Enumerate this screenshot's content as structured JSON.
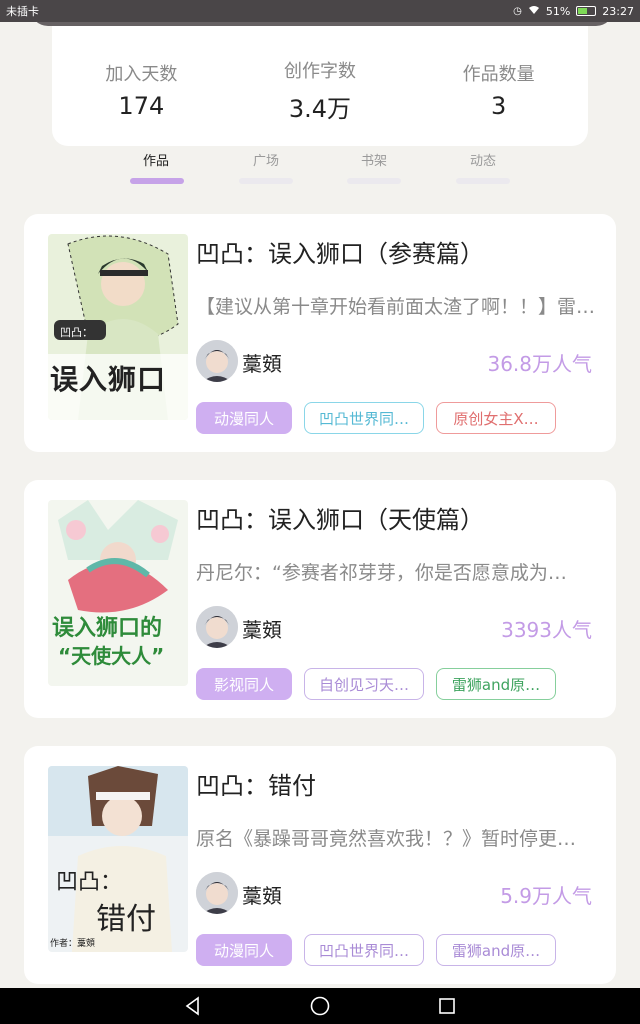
{
  "status_bar": {
    "carrier": "未插卡",
    "battery": "51%",
    "time": "23:27"
  },
  "stats": [
    {
      "label": "加入天数",
      "value": "174"
    },
    {
      "label": "创作字数",
      "value": "3.4万"
    },
    {
      "label": "作品数量",
      "value": "3"
    }
  ],
  "tabs": [
    {
      "label": "作品",
      "active": true
    },
    {
      "label": "广场",
      "active": false
    },
    {
      "label": "书架",
      "active": false
    },
    {
      "label": "动态",
      "active": false
    }
  ],
  "works": [
    {
      "title": "凹凸：误入狮口（参赛篇）",
      "description": "【建议从第十章开始看前面太渣了啊！！】雷…",
      "author": "藳頞",
      "popularity": "36.8万人气",
      "cover_text": [
        "凹凸：",
        "误入狮口"
      ],
      "tags": [
        "动漫同人",
        "凹凸世界同…",
        "原创女主X…"
      ]
    },
    {
      "title": "凹凸：误入狮口（天使篇）",
      "description": "丹尼尔：“参赛者祁芽芽，你是否愿意成为…",
      "author": "藳頞",
      "popularity": "3393人气",
      "cover_text": [
        "误入狮口的",
        "“天使大人”"
      ],
      "tags": [
        "影视同人",
        "自创见习天…",
        "雷狮and原…"
      ]
    },
    {
      "title": "凹凸：错付",
      "description": "原名《暴躁哥哥竟然喜欢我！？》暂时停更…",
      "author": "藳頞",
      "popularity": "5.9万人气",
      "cover_text": [
        "凹凸：",
        "错付",
        "作者：藳頞"
      ],
      "tags": [
        "动漫同人",
        "凹凸世界同…",
        "雷狮and原…"
      ]
    }
  ],
  "colors": {
    "accent": "#c6a3e8",
    "popularity": "#c39be6",
    "background": "#f3f2ee"
  }
}
